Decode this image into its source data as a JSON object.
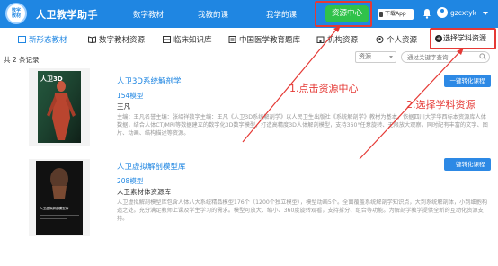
{
  "header": {
    "logo_text": "数字\n教材",
    "app_title": "人卫教学助手",
    "nav": [
      "数字教材",
      "我教的课",
      "我学的课"
    ],
    "resource_center": "资源中心",
    "download_app": "下载App",
    "username": "gzcxtyk"
  },
  "tabs": [
    {
      "label": "新形态教材",
      "active": true
    },
    {
      "label": "数字教材资源",
      "active": false
    },
    {
      "label": "临床知识库",
      "active": false
    },
    {
      "label": "中国医学教育题库",
      "active": false
    },
    {
      "label": "机构资源",
      "active": false
    },
    {
      "label": "个人资源",
      "active": false
    }
  ],
  "add_subject": "选择学科资源",
  "filter": {
    "count_text": "共 2 条记录",
    "select_value": "资源",
    "search_placeholder": "通过关键字查询"
  },
  "items": [
    {
      "title": "人卫3D系统解剖学",
      "count": "154模型",
      "subtitle": "王凡",
      "desc": "主编：王凡名誉主编：张绍祥数字主编：王凡《人卫3D系统解剖学》以人民卫生出版社《系统解剖学》教材为基本，依据四川大学华西标本资源库人体数据，结合人体CT/MRI等数据建立的数字化3D数字模型，打造高精度3D人体解剖模型，支持360°任意旋转、无限放大观察，同时配有丰富的文字、图片、动画、结构描述等资源。",
      "thumb_caption": "人卫3D",
      "action": "一键转化课程"
    },
    {
      "title": "人卫虚拟解剖模型库",
      "count": "208模型",
      "subtitle": "人卫素材体资源库",
      "desc": "人卫虚拟解剖模型库包含人体八大系统精品模型176个（1200个独立模型），模型动画5个。全面覆盖系统解剖学知识点，大到系统解剖体，小到细胞构造之处。充分满足教师上课及学生学习的需求。模型可放大、缩小、360度旋转观看，支持拆分、组合等功能。为解剖学教学提供全新的互动化资源支持。",
      "thumb_caption": "人卫虚拟解剖模型库",
      "action": "一键转化课程"
    }
  ],
  "annotations": {
    "step1": "1.点击资源中心",
    "step2": "2.选择学科资源"
  },
  "colors": {
    "brand_blue": "#1f86e2",
    "green": "#30c24a",
    "annotation_red": "#e53935"
  }
}
